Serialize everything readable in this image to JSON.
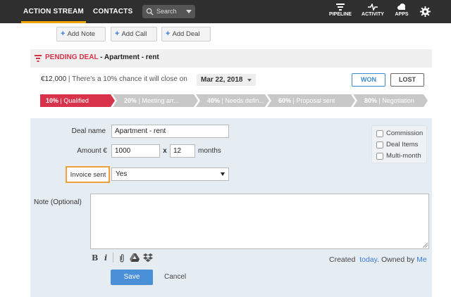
{
  "topbar": {
    "tabs": [
      {
        "label": "ACTION STREAM",
        "active": true
      },
      {
        "label": "CONTACTS",
        "active": false
      }
    ],
    "search_placeholder": "Search",
    "nav": [
      {
        "label": "PIPELINE",
        "icon": "filter-icon"
      },
      {
        "label": "ACTIVITY",
        "icon": "pulse-icon"
      },
      {
        "label": "APPS",
        "icon": "cloud-icon"
      }
    ],
    "settings_icon": "gear-icon",
    "accent_color": "#f0a500"
  },
  "add_buttons": [
    {
      "label": "Add Note"
    },
    {
      "label": "Add Call"
    },
    {
      "label": "Add Deal"
    }
  ],
  "deal": {
    "status_label": "PENDING DEAL",
    "separator": " - ",
    "title": "Apartment - rent",
    "amount": "€12,000",
    "chance_text": " | There's a 10% chance it will close on",
    "close_date": "Mar 22, 2018",
    "won_label": "WON",
    "lost_label": "LOST",
    "stages": [
      {
        "pct": "10%",
        "name": "Qualified",
        "active": true
      },
      {
        "pct": "20%",
        "name": "Meeting arr...",
        "active": false
      },
      {
        "pct": "40%",
        "name": "Needs defin...",
        "active": false
      },
      {
        "pct": "60%",
        "name": "Proposal sent",
        "active": false
      },
      {
        "pct": "80%",
        "name": "Negotiation",
        "active": false
      }
    ],
    "stage_colors": {
      "active": "#d8334a",
      "inactive": "#c8c8c8"
    }
  },
  "form": {
    "deal_name_label": "Deal name",
    "deal_name_value": "Apartment - rent",
    "amount_label": "Amount €",
    "amount_value": "1000",
    "times": "x",
    "months_value": "12",
    "months_label": "months",
    "invoice_label": "Invoice sent",
    "invoice_value": "Yes",
    "options": [
      "Commission",
      "Deal Items",
      "Multi-month"
    ],
    "note_label": "Note (Optional)",
    "note_value": "",
    "created_prefix": "Created",
    "created_when": "today",
    "owned_text": ". Owned by",
    "owner": "Me",
    "save_label": "Save",
    "cancel_label": "Cancel"
  }
}
